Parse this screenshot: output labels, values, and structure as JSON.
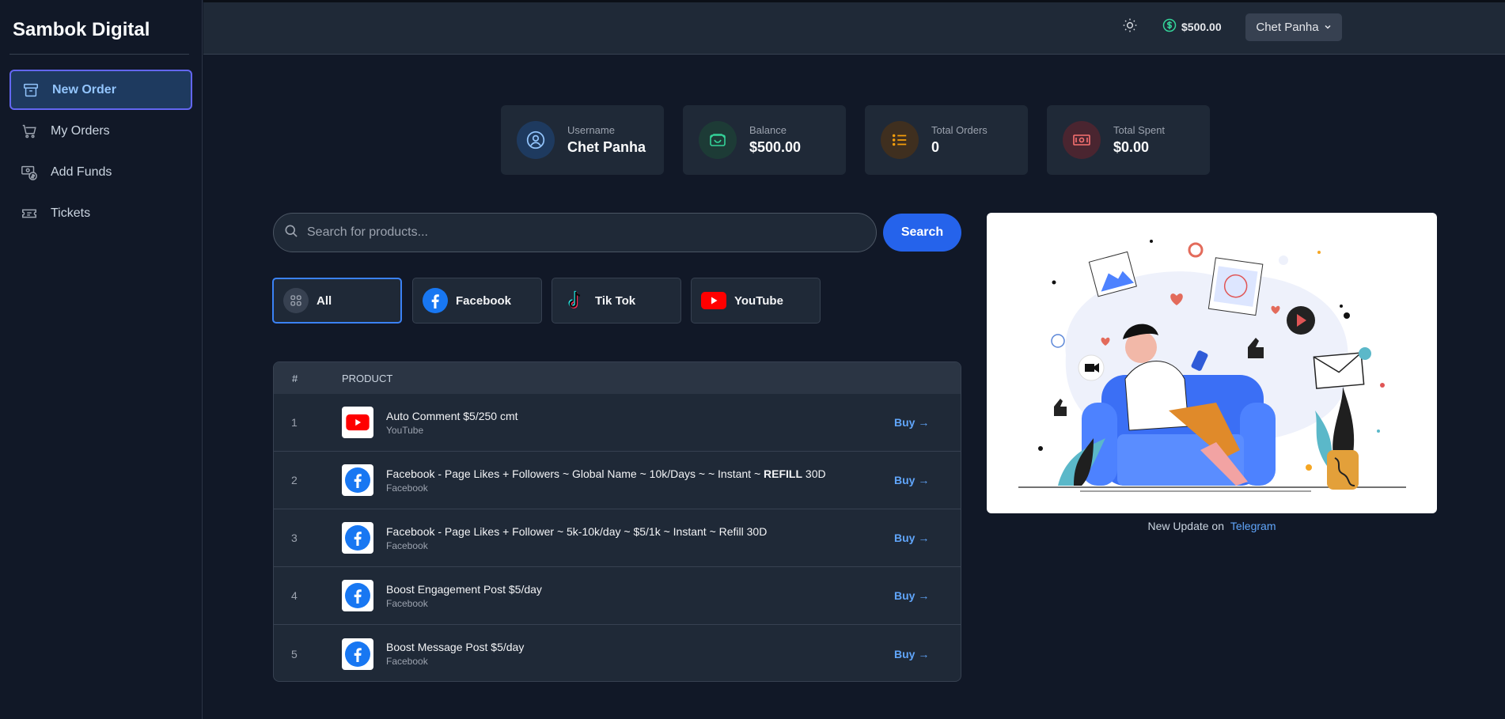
{
  "sidebar": {
    "brand": "Sambok Digital",
    "items": [
      {
        "label": "New Order",
        "icon": "archive-icon",
        "active": true
      },
      {
        "label": "My Orders",
        "icon": "cart-icon",
        "active": false
      },
      {
        "label": "Add Funds",
        "icon": "funds-icon",
        "active": false
      },
      {
        "label": "Tickets",
        "icon": "ticket-icon",
        "active": false
      }
    ]
  },
  "header": {
    "theme_icon": "sun-icon",
    "balance": "$500.00",
    "user": "Chet Panha"
  },
  "stats": [
    {
      "label": "Username",
      "value": "Chet Panha",
      "icon": "user-icon",
      "color": "#60a5fa"
    },
    {
      "label": "Balance",
      "value": "$500.00",
      "icon": "wallet-icon",
      "color": "#34d399"
    },
    {
      "label": "Total Orders",
      "value": "0",
      "icon": "list-icon",
      "color": "#f59e0b"
    },
    {
      "label": "Total Spent",
      "value": "$0.00",
      "icon": "money-icon",
      "color": "#f87171"
    }
  ],
  "search": {
    "placeholder": "Search for products...",
    "button": "Search"
  },
  "categories": [
    {
      "label": "All",
      "icon": "grid-icon",
      "active": true
    },
    {
      "label": "Facebook",
      "icon": "facebook-icon",
      "active": false
    },
    {
      "label": "Tik Tok",
      "icon": "tiktok-icon",
      "active": false
    },
    {
      "label": "YouTube",
      "icon": "youtube-icon",
      "active": false
    }
  ],
  "table": {
    "headers": [
      "#",
      "PRODUCT"
    ],
    "buy_label": "Buy →",
    "rows": [
      {
        "num": "1",
        "name": "Auto Comment $5/250 cmt",
        "platform": "YouTube",
        "icon": "youtube-icon"
      },
      {
        "num": "2",
        "name": "Facebook - Page Likes + Followers ~ Global Name ~ 10k/Days ~ ~ Instant ~ REFILL 30D",
        "platform": "Facebook",
        "icon": "facebook-icon"
      },
      {
        "num": "3",
        "name": "Facebook - Page Likes + Follower ~ 5k-10k/day ~ $5/1k ~ Instant ~ Refill 30D",
        "platform": "Facebook",
        "icon": "facebook-icon"
      },
      {
        "num": "4",
        "name": "Boost Engagement Post $5/day",
        "platform": "Facebook",
        "icon": "facebook-icon"
      },
      {
        "num": "5",
        "name": "Boost Message Post $5/day",
        "platform": "Facebook",
        "icon": "facebook-icon"
      }
    ]
  },
  "promo": {
    "text": "New Update on",
    "link": "Telegram"
  },
  "colors": {
    "accent": "#2563eb",
    "background": "#111827",
    "card": "#1f2937"
  }
}
